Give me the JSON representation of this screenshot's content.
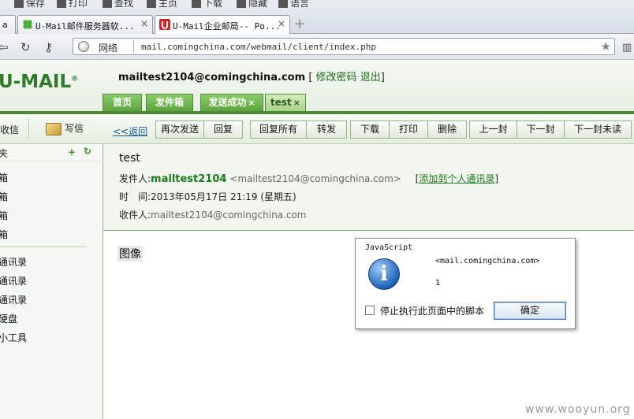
{
  "browser": {
    "top_toolbar": [
      "保存",
      "打印",
      "查找",
      "主页",
      "下载",
      "隐藏",
      "语言"
    ],
    "tabs": [
      {
        "label": "a",
        "close": ""
      },
      {
        "label": "U-Mail邮件服务器软...",
        "close": "×"
      },
      {
        "label": "U-Mail企业邮局-- Po...",
        "close": "×"
      }
    ],
    "new_tab": "+",
    "nav": {
      "back": "⇦",
      "reload": "↻",
      "key": "⚷"
    },
    "address": {
      "zone": "网络",
      "url": "mail.comingchina.com/webmail/client/index.php",
      "star": "★"
    },
    "side": "▥"
  },
  "mail": {
    "logo": "U-MAIL",
    "logo_reg": "®",
    "user_email": "mailtest2104@comingchina.com",
    "user_links": {
      "open": "[",
      "change_password": "修改密码",
      "logout": "退出",
      "close": "]"
    },
    "tabs": [
      {
        "label": "首页",
        "close": ""
      },
      {
        "label": "发件箱",
        "close": ""
      },
      {
        "label": "发送成功",
        "close": "×"
      },
      {
        "label": "test",
        "close": "×"
      }
    ],
    "left": {
      "receive": "收信",
      "write": "写信",
      "folder_header": "夹",
      "add": "+",
      "refresh": "↻",
      "folders": [
        "箱",
        "箱",
        "箱",
        "箱"
      ],
      "tools": [
        "通讯录",
        "通讯录",
        "通讯录",
        "硬盘",
        "小工具"
      ]
    },
    "toolbar": {
      "back": "<<返回",
      "buttons": [
        "再次发送",
        "回复",
        "回复所有",
        "转发",
        "下载",
        "打印",
        "删除",
        "上一封",
        "下一封",
        "下一封未读"
      ]
    },
    "message": {
      "subject": "test",
      "from_label": "发件人:",
      "from_name": "mailtest2104",
      "from_addr": "<mailtest2104@comingchina.com>",
      "add_contact_open": "[",
      "add_contact": "添加到个人通讯录",
      "add_contact_close": "]",
      "time_label": "时　间:",
      "time_value": "2013年05月17日 21:19 (星期五)",
      "to_label": "收件人:",
      "to_value": "mailtest2104@comingchina.com",
      "body": "图像"
    }
  },
  "dialog": {
    "title": "JavaScript",
    "message_line1": "<mail.comingchina.com>",
    "message_line2": "1",
    "checkbox_label": "停止执行此页面中的脚本",
    "ok_label": "确定",
    "icon": "i"
  },
  "watermark": "www.wooyun.org"
}
